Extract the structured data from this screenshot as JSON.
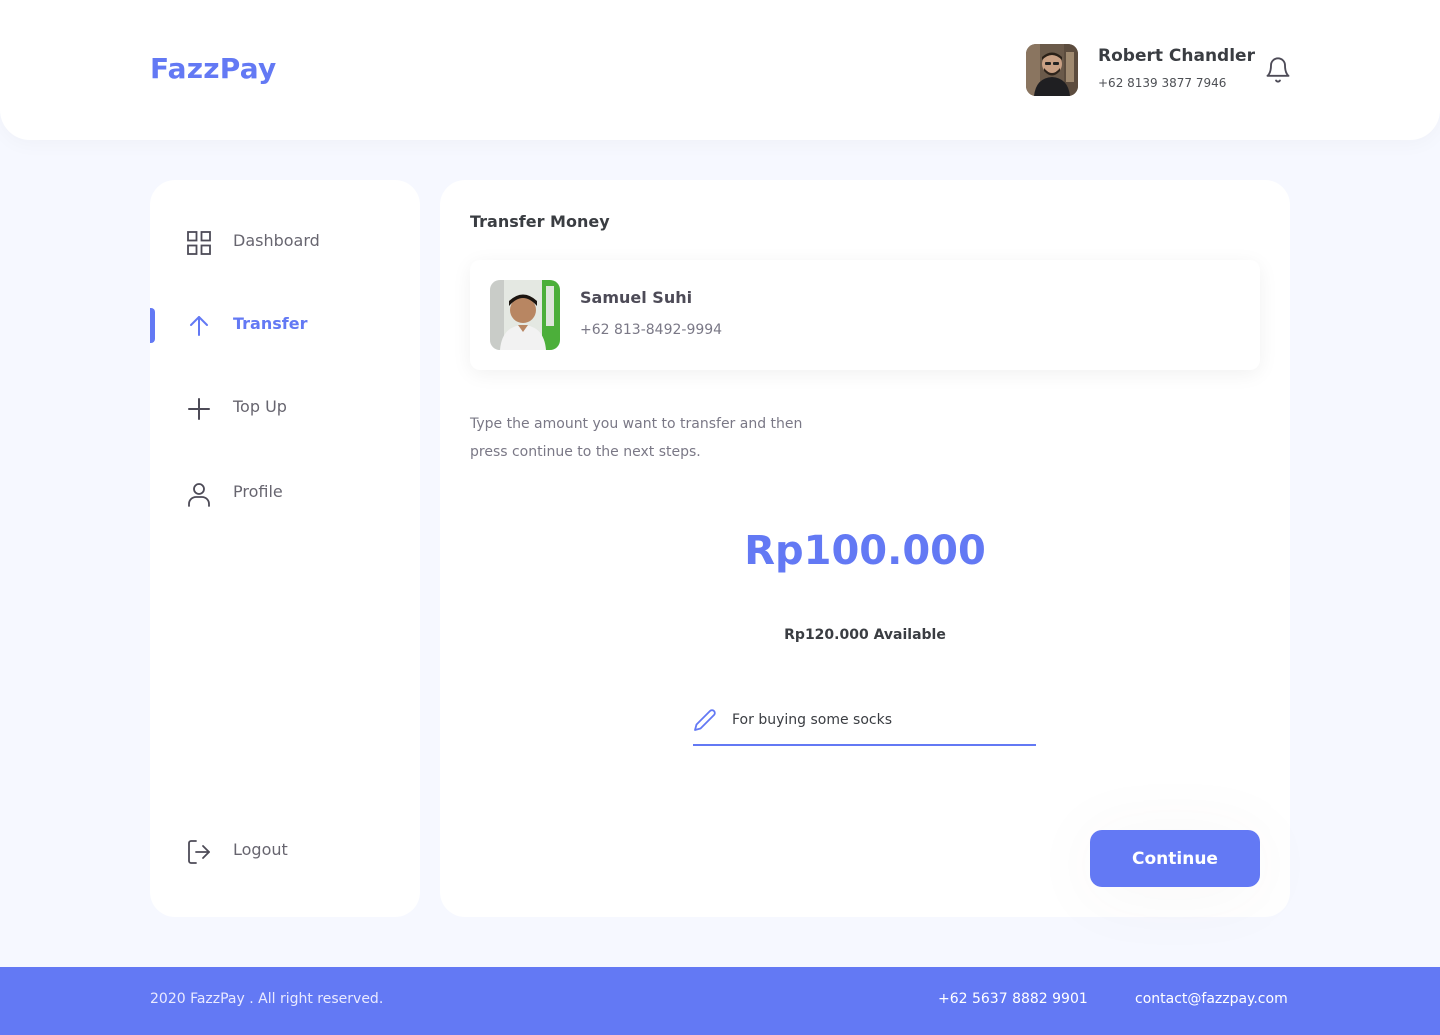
{
  "header": {
    "brand": "FazzPay",
    "user": {
      "name": "Robert Chandler",
      "phone": "+62 8139 3877 7946"
    },
    "icons": {
      "notification": "bell-icon"
    }
  },
  "sidebar": {
    "items": [
      {
        "label": "Dashboard",
        "icon": "grid-icon",
        "active": false
      },
      {
        "label": "Transfer",
        "icon": "arrow-up-icon",
        "active": true
      },
      {
        "label": "Top Up",
        "icon": "plus-icon",
        "active": false
      },
      {
        "label": "Profile",
        "icon": "user-icon",
        "active": false
      }
    ],
    "logout": {
      "label": "Logout",
      "icon": "logout-icon"
    }
  },
  "main": {
    "title": "Transfer Money",
    "recipient": {
      "name": "Samuel Suhi",
      "phone": "+62 813-8492-9994"
    },
    "instruction": "Type the amount you want to transfer and then press continue to the next steps.",
    "amount": "Rp100.000",
    "available": "Rp120.000 Available",
    "note": {
      "value": "For buying some socks",
      "icon": "pencil-icon"
    },
    "continue_label": "Continue"
  },
  "footer": {
    "copyright": "2020 FazzPay . All right reserved.",
    "phone": "+62 5637 8882 9901",
    "email": "contact@fazzpay.com"
  },
  "colors": {
    "primary": "#6379f4",
    "background": "#f6f8ff",
    "text": "#3a3d42",
    "muted": "#7a7886"
  }
}
